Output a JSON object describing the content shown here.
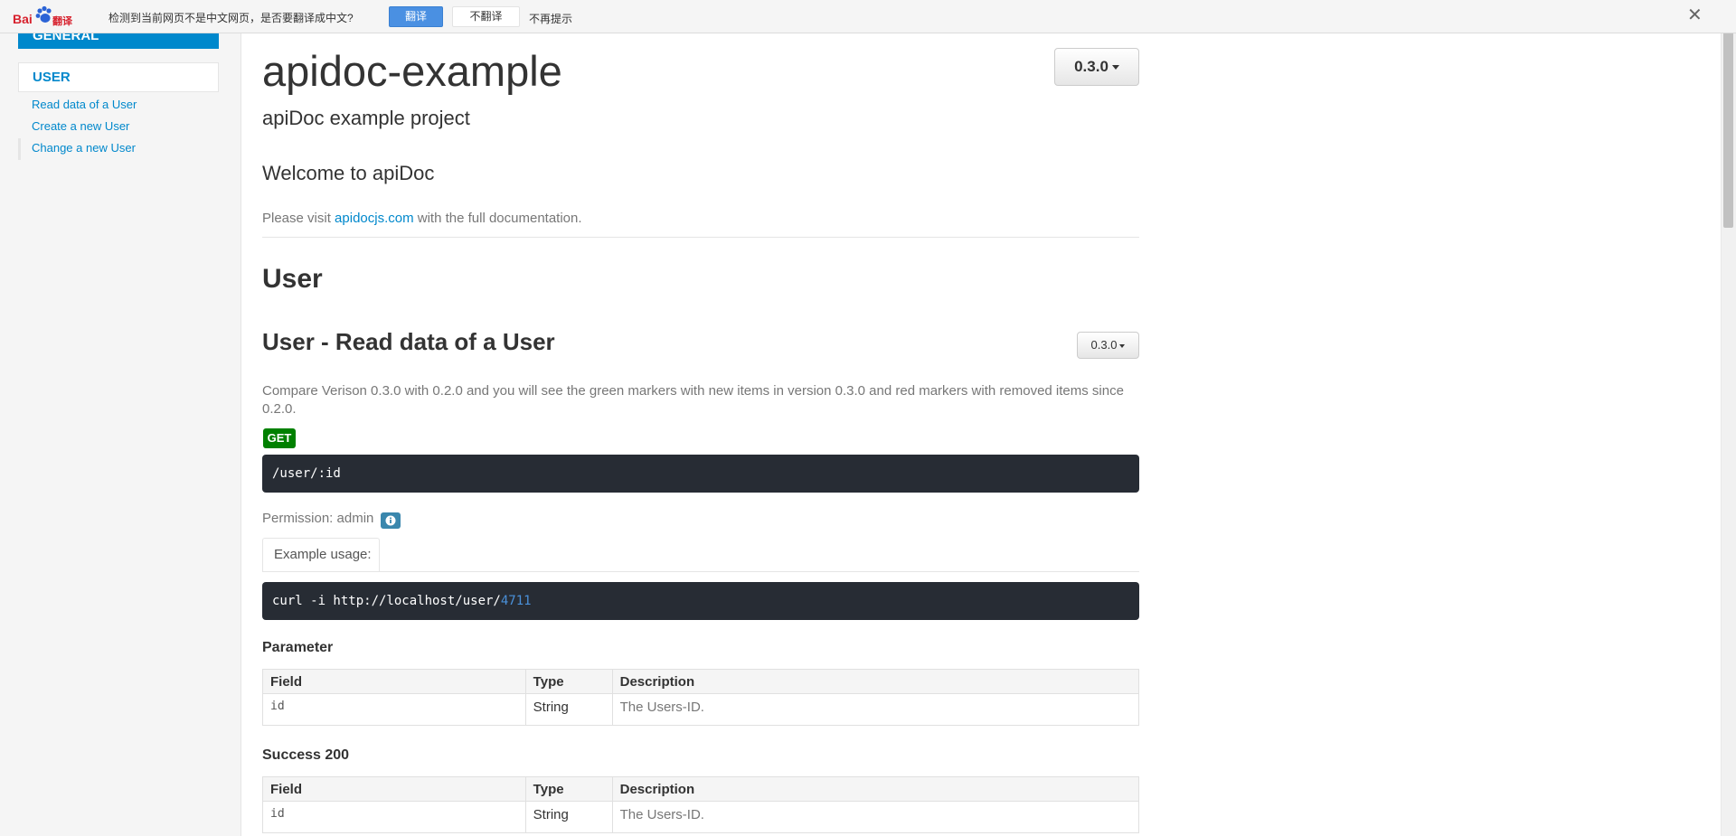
{
  "translate_bar": {
    "logo_bai": "Bai",
    "logo_fanyi": "翻译",
    "message": "检测到当前网页不是中文网页，是否要翻译成中文?",
    "translate_label": "翻译",
    "no_translate_label": "不翻译",
    "never_label": "不再提示",
    "close_glyph": "✕"
  },
  "sidebar": {
    "general_label": "GENERAL",
    "user_label": "USER",
    "items": [
      {
        "label": "Read data of a User"
      },
      {
        "label": "Create a new User"
      },
      {
        "label": "Change a new User"
      }
    ]
  },
  "header": {
    "title": "apidoc-example",
    "subtitle": "apiDoc example project",
    "version": "0.3.0"
  },
  "intro": {
    "welcome": "Welcome to apiDoc",
    "visit_prefix": "Please visit ",
    "visit_link": "apidocjs.com",
    "visit_suffix": " with the full documentation."
  },
  "section": {
    "group_title": "User",
    "endpoint_title": "User - Read data of a User",
    "version": "0.3.0",
    "compare_text": "Compare Verison 0.3.0 with 0.2.0 and you will see the green markers with new items in version 0.3.0 and red markers with removed items since 0.2.0.",
    "method": "GET",
    "path": "/user/:id",
    "permission": "Permission: admin",
    "example_tab": "Example usage:",
    "example_code_prefix": "curl -i http://localhost/user/",
    "example_code_num": "4711",
    "parameter_title": "Parameter",
    "success_title": "Success 200",
    "table_headers": {
      "field": "Field",
      "type": "Type",
      "description": "Description"
    },
    "parameter_rows": [
      {
        "field": "id",
        "type": "String",
        "description": "The Users-ID."
      }
    ],
    "success_rows": [
      {
        "field": "id",
        "type": "String",
        "description": "The Users-ID."
      }
    ]
  },
  "colors": {
    "accent": "#0088cc",
    "get_badge": "#008000",
    "code_bg": "#272c34",
    "translate_button": "#4a90e2"
  }
}
